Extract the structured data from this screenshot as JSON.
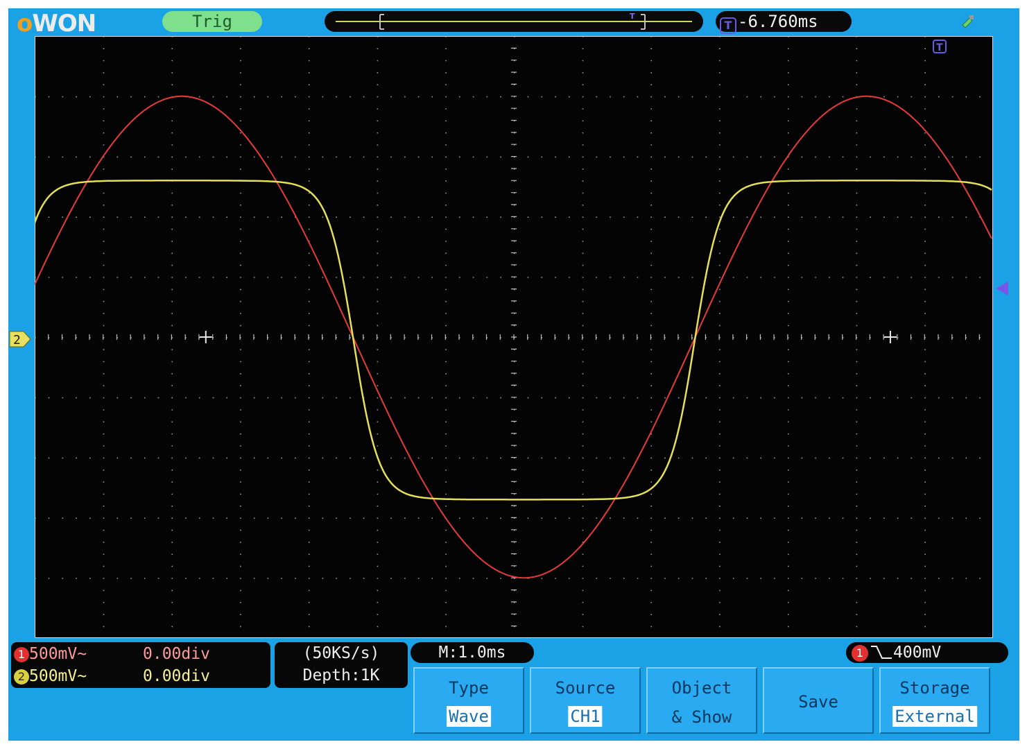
{
  "brand": {
    "logo": "OWON"
  },
  "status": {
    "trigger_state": "Trig",
    "trigger_position": "-6.760ms"
  },
  "channels": [
    {
      "id": "1",
      "volts_div": "500mV~",
      "offset": "0.00div",
      "color": "#e03030"
    },
    {
      "id": "2",
      "volts_div": "500mV~",
      "offset": "0.00div",
      "color": "#e8e060"
    }
  ],
  "acquisition": {
    "sample_rate": "(50KS/s)",
    "depth": "Depth:1K"
  },
  "timebase": {
    "label": "M:1.0ms"
  },
  "trigger": {
    "channel": "1",
    "level": "400mV"
  },
  "markers": {
    "ch2": "2",
    "ch1": "1"
  },
  "softkeys": [
    {
      "label": "Type",
      "value": "Wave"
    },
    {
      "label": "Source",
      "value": "CH1"
    },
    {
      "label": "Object",
      "value": "& Show"
    },
    {
      "label": "Save",
      "value": ""
    },
    {
      "label": "Storage",
      "value": "External"
    }
  ],
  "icons": {
    "trigger_position": "trigger-t-icon",
    "usb": "usb-icon"
  },
  "colors": {
    "background": "#1aa1e6",
    "screen": "#040404",
    "ch1": "#e03030",
    "ch2": "#e8e060"
  }
}
